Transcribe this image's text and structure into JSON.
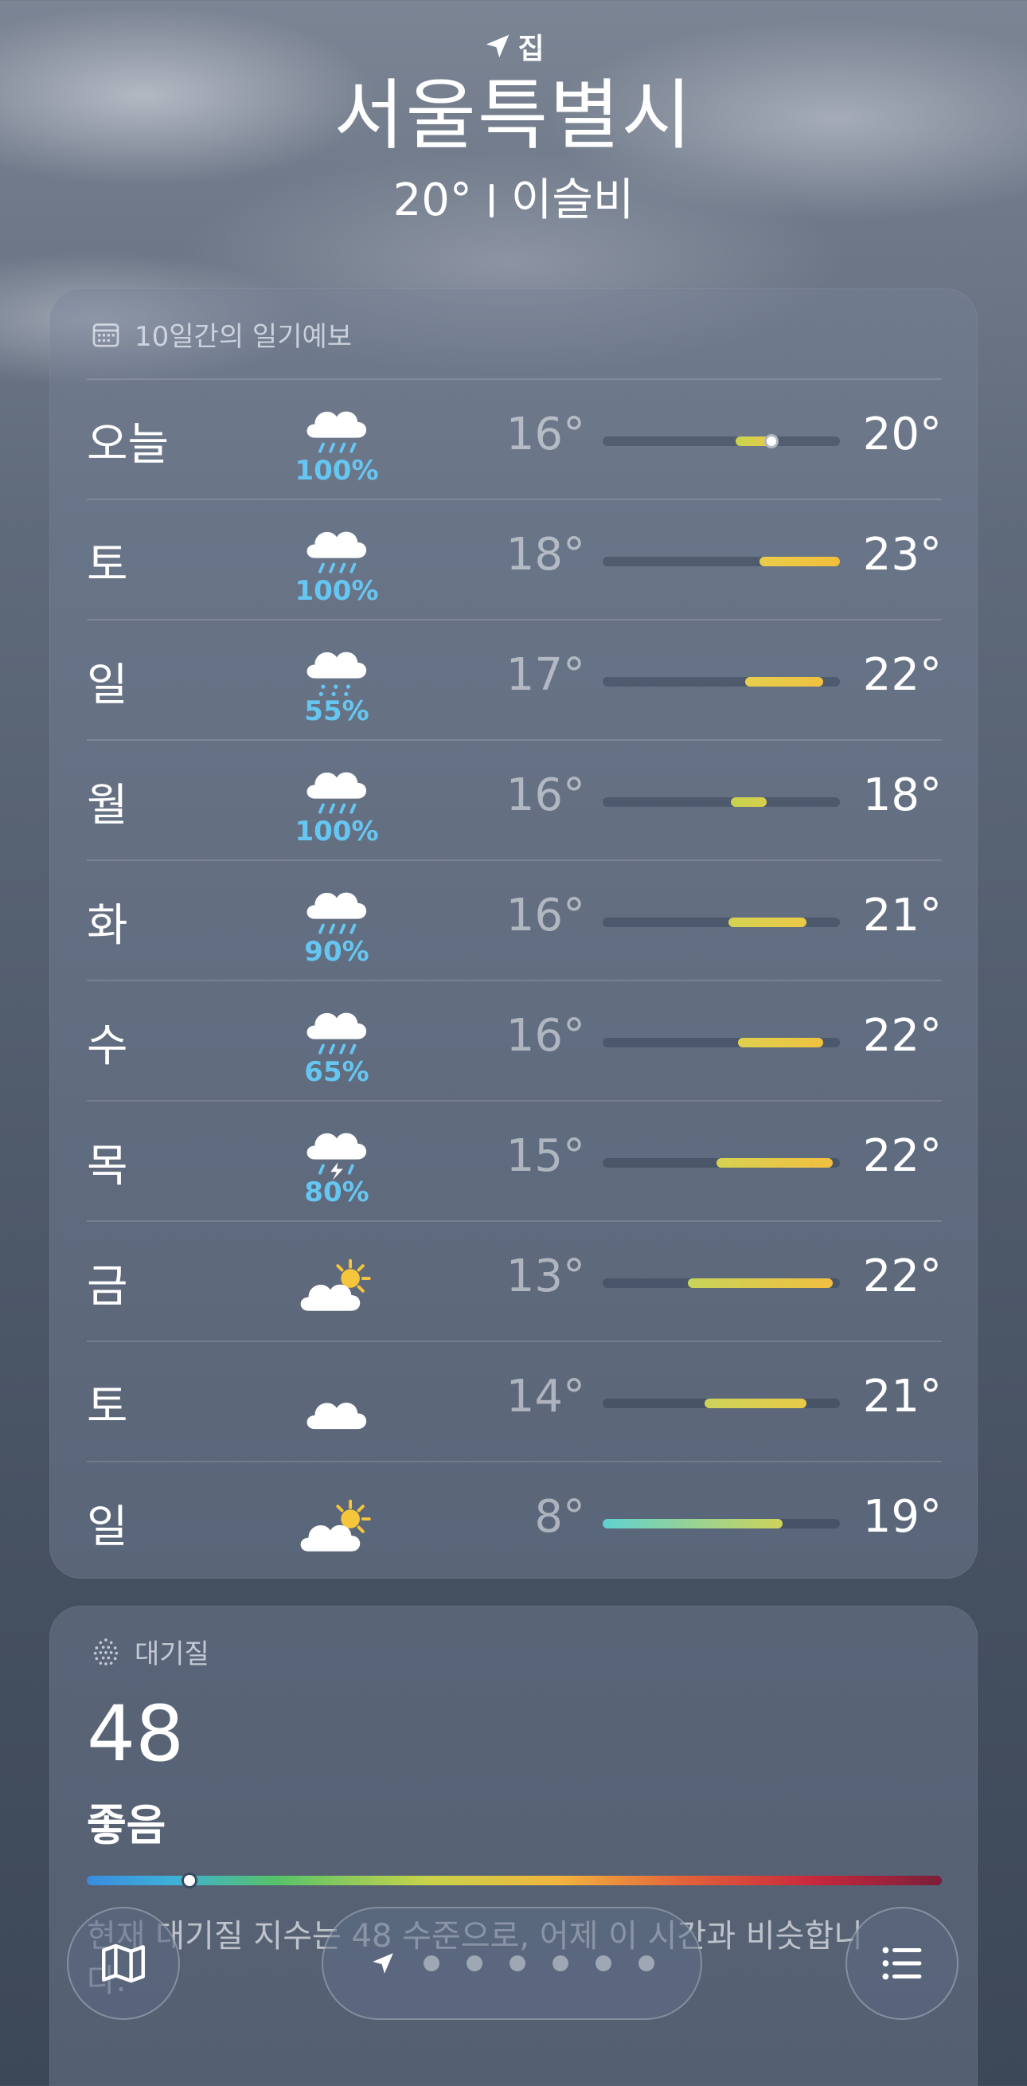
{
  "header": {
    "location_label": "집",
    "city": "서울특별시",
    "current_temp": "20°",
    "condition": "이슬비"
  },
  "forecast": {
    "title": "10일간의 일기예보",
    "days": [
      {
        "day": "오늘",
        "icon": "cloud-rain-icon",
        "pop": "100%",
        "low": "16°",
        "high": "20°",
        "range_start": 0.56,
        "range_end": 0.72,
        "current": 0.71,
        "colors": [
          "#c8d44e",
          "#e9c94a"
        ]
      },
      {
        "day": "토",
        "icon": "cloud-rain-icon",
        "pop": "100%",
        "low": "18°",
        "high": "23°",
        "range_start": 0.66,
        "range_end": 1.0,
        "current": null,
        "colors": [
          "#e9cc4b",
          "#f2be3c"
        ]
      },
      {
        "day": "일",
        "icon": "cloud-drizzle-icon",
        "pop": "55%",
        "low": "17°",
        "high": "22°",
        "range_start": 0.6,
        "range_end": 0.93,
        "current": null,
        "colors": [
          "#e5cf4d",
          "#f0c141"
        ]
      },
      {
        "day": "월",
        "icon": "cloud-rain-icon",
        "pop": "100%",
        "low": "16°",
        "high": "18°",
        "range_start": 0.54,
        "range_end": 0.69,
        "current": null,
        "colors": [
          "#c6d34f",
          "#d8cf4c"
        ]
      },
      {
        "day": "화",
        "icon": "cloud-rain-icon",
        "pop": "90%",
        "low": "16°",
        "high": "21°",
        "range_start": 0.53,
        "range_end": 0.86,
        "current": null,
        "colors": [
          "#d4d253",
          "#ecc845"
        ]
      },
      {
        "day": "수",
        "icon": "cloud-rain-icon",
        "pop": "65%",
        "low": "16°",
        "high": "22°",
        "range_start": 0.57,
        "range_end": 0.93,
        "current": null,
        "colors": [
          "#dfd04e",
          "#f0c241"
        ]
      },
      {
        "day": "목",
        "icon": "cloud-bolt-rain-icon",
        "pop": "80%",
        "low": "15°",
        "high": "22°",
        "range_start": 0.48,
        "range_end": 0.97,
        "current": null,
        "colors": [
          "#d6d152",
          "#f2bf3f"
        ]
      },
      {
        "day": "금",
        "icon": "cloud-sun-icon",
        "pop": "",
        "low": "13°",
        "high": "22°",
        "range_start": 0.36,
        "range_end": 0.97,
        "current": null,
        "colors": [
          "#c8d45a",
          "#f2bf3f"
        ]
      },
      {
        "day": "토",
        "icon": "cloud-icon",
        "pop": "",
        "low": "14°",
        "high": "21°",
        "range_start": 0.43,
        "range_end": 0.86,
        "current": null,
        "colors": [
          "#ccd35a",
          "#e8c947"
        ]
      },
      {
        "day": "일",
        "icon": "cloud-sun-icon",
        "pop": "",
        "low": "8°",
        "high": "19°",
        "range_start": 0.0,
        "range_end": 0.76,
        "current": null,
        "colors": [
          "#5fd2d0",
          "#cfd35a"
        ]
      }
    ]
  },
  "air_quality": {
    "title": "대기질",
    "value": "48",
    "level": "좋음",
    "position": 0.12,
    "description": "현재 대기질 지수는 48 수준으로, 어제 이 시간과 비슷합니다."
  },
  "toolbar": {
    "map_icon": "map-icon",
    "list_icon": "list-icon",
    "pages": 7,
    "current_page": 0
  }
}
